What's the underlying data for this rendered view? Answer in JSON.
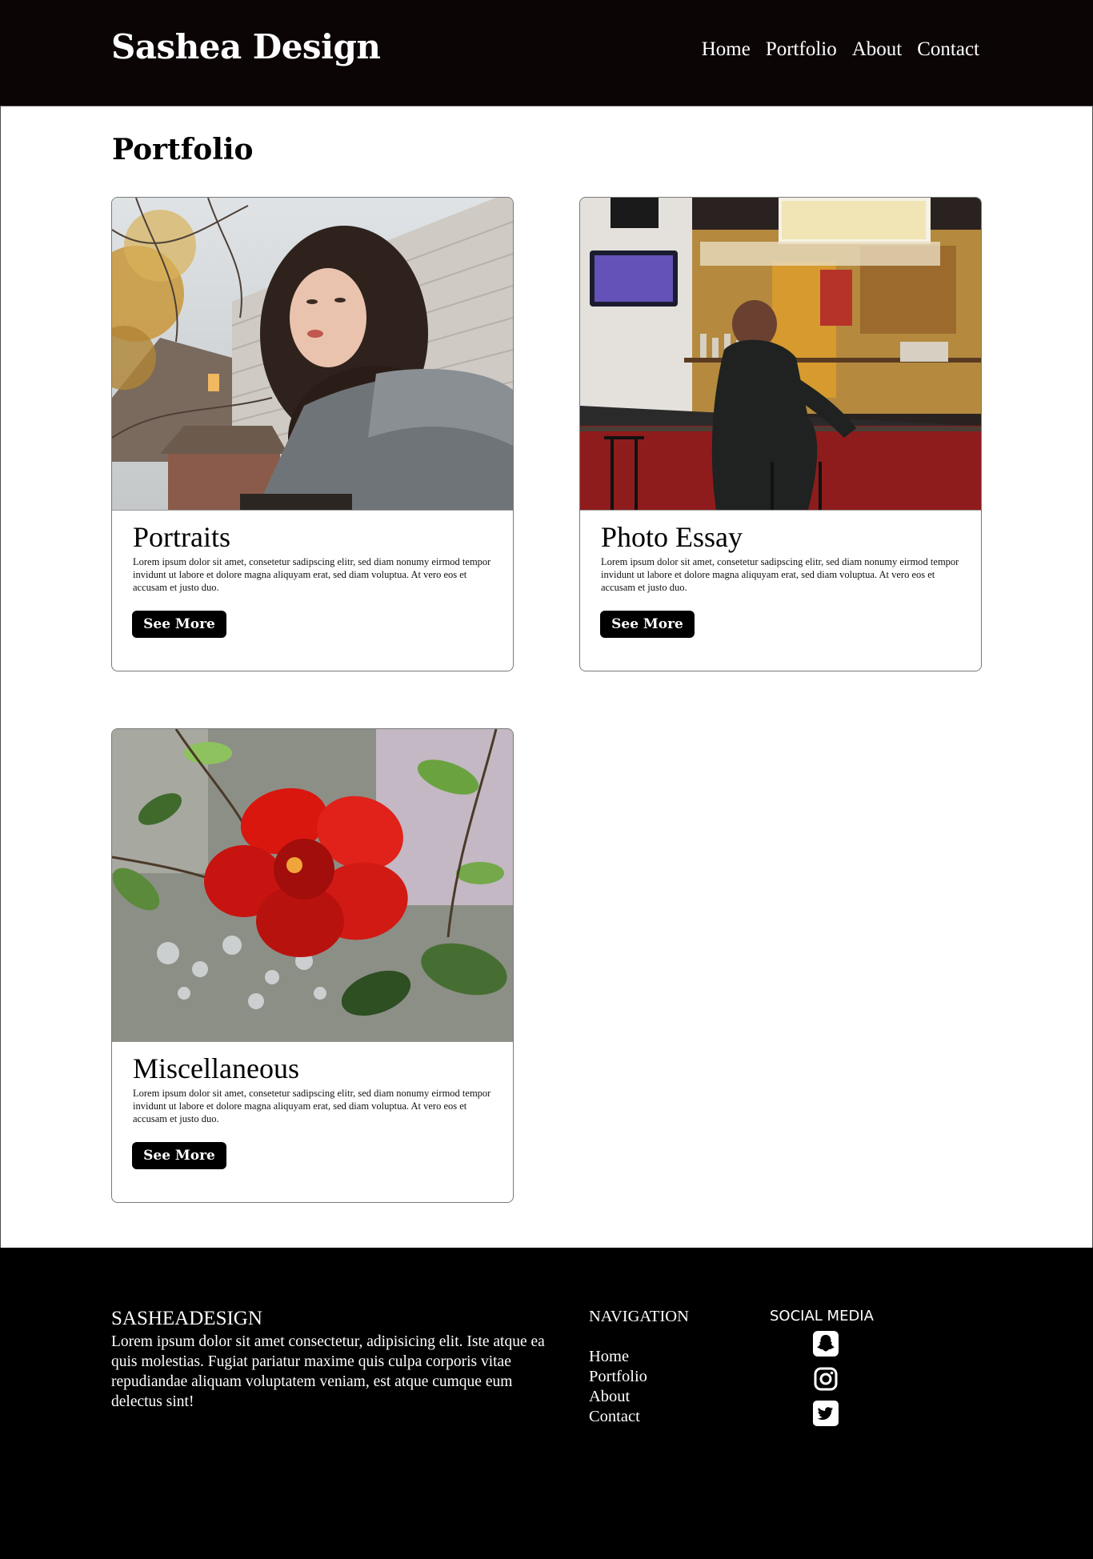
{
  "header": {
    "brand": "Sashea Design",
    "nav": [
      "Home",
      "Portfolio",
      "About",
      "Contact"
    ]
  },
  "main": {
    "title": "Portfolio",
    "cards": [
      {
        "title": "Portraits",
        "text": "Lorem ipsum dolor sit amet, consetetur sadipscing elitr, sed diam nonumy eirmod tempor invidunt ut labore et dolore magna aliquyam erat, sed diam voluptua. At vero eos et accusam et justo duo.",
        "button": "See More"
      },
      {
        "title": "Photo Essay",
        "text": "Lorem ipsum dolor sit amet, consetetur sadipscing elitr, sed diam nonumy eirmod tempor invidunt ut labore et dolore magna aliquyam erat, sed diam voluptua. At vero eos et accusam et justo duo.",
        "button": "See More"
      },
      {
        "title": "Miscellaneous",
        "text": "Lorem ipsum dolor sit amet, consetetur sadipscing elitr, sed diam nonumy eirmod tempor invidunt ut labore et dolore magna aliquyam erat, sed diam voluptua. At vero eos et accusam et justo duo.",
        "button": "See More"
      }
    ]
  },
  "footer": {
    "brand": "SASHEADESIGN",
    "text": "Lorem ipsum dolor sit amet consectetur, adipisicing elit. Iste atque ea quis molestias. Fugiat pariatur maxime quis culpa corporis vitae repudiandae aliquam voluptatem veniam, est atque cumque eum delectus sint!",
    "nav_title": "NAVIGATION",
    "nav": [
      "Home",
      "Portfolio",
      "About",
      "Contact"
    ],
    "social_title": "SOCIAL MEDIA",
    "social_icons": [
      "snapchat-icon",
      "instagram-icon",
      "twitter-icon"
    ]
  },
  "colors": {
    "header_bg": "#0c0506",
    "footer_bg": "#000000",
    "button_bg": "#000000"
  }
}
